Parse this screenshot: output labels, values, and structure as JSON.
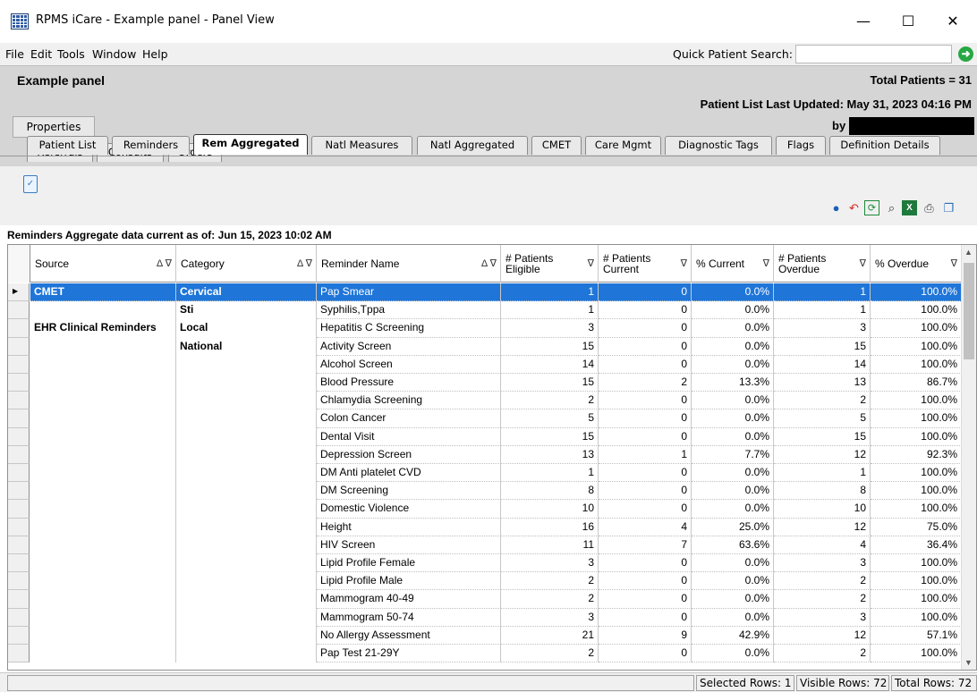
{
  "window": {
    "title": "RPMS iCare - Example panel - Panel View",
    "minimize": "—",
    "maximize": "☐",
    "close": "✕"
  },
  "menu": [
    "File",
    "Edit",
    "Tools",
    "Window",
    "Help"
  ],
  "quick_search": {
    "label": "Quick Patient Search:",
    "value": "",
    "go_icon": "go-arrow-icon"
  },
  "panel": {
    "title": "Example panel",
    "total_patients": "Total Patients = 31",
    "last_updated": "Patient List Last Updated: May 31, 2023 04:16 PM",
    "by_label": "by",
    "properties_button": "Properties"
  },
  "tabs_row1": [
    "Referrals",
    "Consults",
    "Orders"
  ],
  "tabs_row2": [
    "Patient List",
    "Reminders",
    "Rem Aggregated",
    "Natl Measures",
    "Natl Aggregated",
    "CMET",
    "Care Mgmt",
    "Diagnostic Tags",
    "Flags",
    "Definition Details"
  ],
  "active_tab": "Rem Aggregated",
  "toolbar_icons": [
    "help-icon",
    "undo-icon",
    "refresh-icon",
    "find-icon",
    "excel-icon",
    "print-icon",
    "copy-icon"
  ],
  "aggregate_label": "Reminders Aggregate data current as of:  Jun 15, 2023 10:02 AM",
  "grid": {
    "columns": [
      {
        "label": "Source",
        "icons": "Δ ∇"
      },
      {
        "label": "Category",
        "icons": "Δ ∇"
      },
      {
        "label": "Reminder Name",
        "icons": "Δ ∇"
      },
      {
        "label": "# Patients Eligible",
        "icons": "∇"
      },
      {
        "label": "# Patients Current",
        "icons": "∇"
      },
      {
        "label": "% Current",
        "icons": "∇"
      },
      {
        "label": "# Patients Overdue",
        "icons": "∇"
      },
      {
        "label": "% Overdue",
        "icons": "∇"
      }
    ],
    "rows": [
      [
        "CMET",
        "Cervical",
        "Pap Smear",
        "1",
        "0",
        "0.0%",
        "1",
        "100.0%"
      ],
      [
        "",
        "Sti",
        "Syphilis,Tppa",
        "1",
        "0",
        "0.0%",
        "1",
        "100.0%"
      ],
      [
        "EHR Clinical Reminders",
        "Local",
        "Hepatitis C Screening",
        "3",
        "0",
        "0.0%",
        "3",
        "100.0%"
      ],
      [
        "",
        "National",
        "Activity Screen",
        "15",
        "0",
        "0.0%",
        "15",
        "100.0%"
      ],
      [
        "",
        "",
        "Alcohol Screen",
        "14",
        "0",
        "0.0%",
        "14",
        "100.0%"
      ],
      [
        "",
        "",
        "Blood Pressure",
        "15",
        "2",
        "13.3%",
        "13",
        "86.7%"
      ],
      [
        "",
        "",
        "Chlamydia Screening",
        "2",
        "0",
        "0.0%",
        "2",
        "100.0%"
      ],
      [
        "",
        "",
        "Colon Cancer",
        "5",
        "0",
        "0.0%",
        "5",
        "100.0%"
      ],
      [
        "",
        "",
        "Dental Visit",
        "15",
        "0",
        "0.0%",
        "15",
        "100.0%"
      ],
      [
        "",
        "",
        "Depression Screen",
        "13",
        "1",
        "7.7%",
        "12",
        "92.3%"
      ],
      [
        "",
        "",
        "DM Anti platelet CVD",
        "1",
        "0",
        "0.0%",
        "1",
        "100.0%"
      ],
      [
        "",
        "",
        "DM Screening",
        "8",
        "0",
        "0.0%",
        "8",
        "100.0%"
      ],
      [
        "",
        "",
        "Domestic Violence",
        "10",
        "0",
        "0.0%",
        "10",
        "100.0%"
      ],
      [
        "",
        "",
        "Height",
        "16",
        "4",
        "25.0%",
        "12",
        "75.0%"
      ],
      [
        "",
        "",
        "HIV Screen",
        "11",
        "7",
        "63.6%",
        "4",
        "36.4%"
      ],
      [
        "",
        "",
        "Lipid Profile Female",
        "3",
        "0",
        "0.0%",
        "3",
        "100.0%"
      ],
      [
        "",
        "",
        "Lipid Profile Male",
        "2",
        "0",
        "0.0%",
        "2",
        "100.0%"
      ],
      [
        "",
        "",
        "Mammogram 40-49",
        "2",
        "0",
        "0.0%",
        "2",
        "100.0%"
      ],
      [
        "",
        "",
        "Mammogram 50-74",
        "3",
        "0",
        "0.0%",
        "3",
        "100.0%"
      ],
      [
        "",
        "",
        "No Allergy Assessment",
        "21",
        "9",
        "42.9%",
        "12",
        "57.1%"
      ],
      [
        "",
        "",
        "Pap Test 21-29Y",
        "2",
        "0",
        "0.0%",
        "2",
        "100.0%"
      ]
    ]
  },
  "status": {
    "selected": "Selected Rows: 1",
    "visible": "Visible Rows: 72",
    "total": "Total Rows: 72"
  },
  "colors": {
    "selection": "#1f75d8",
    "panel_header_bg": "#d5d5d5"
  }
}
